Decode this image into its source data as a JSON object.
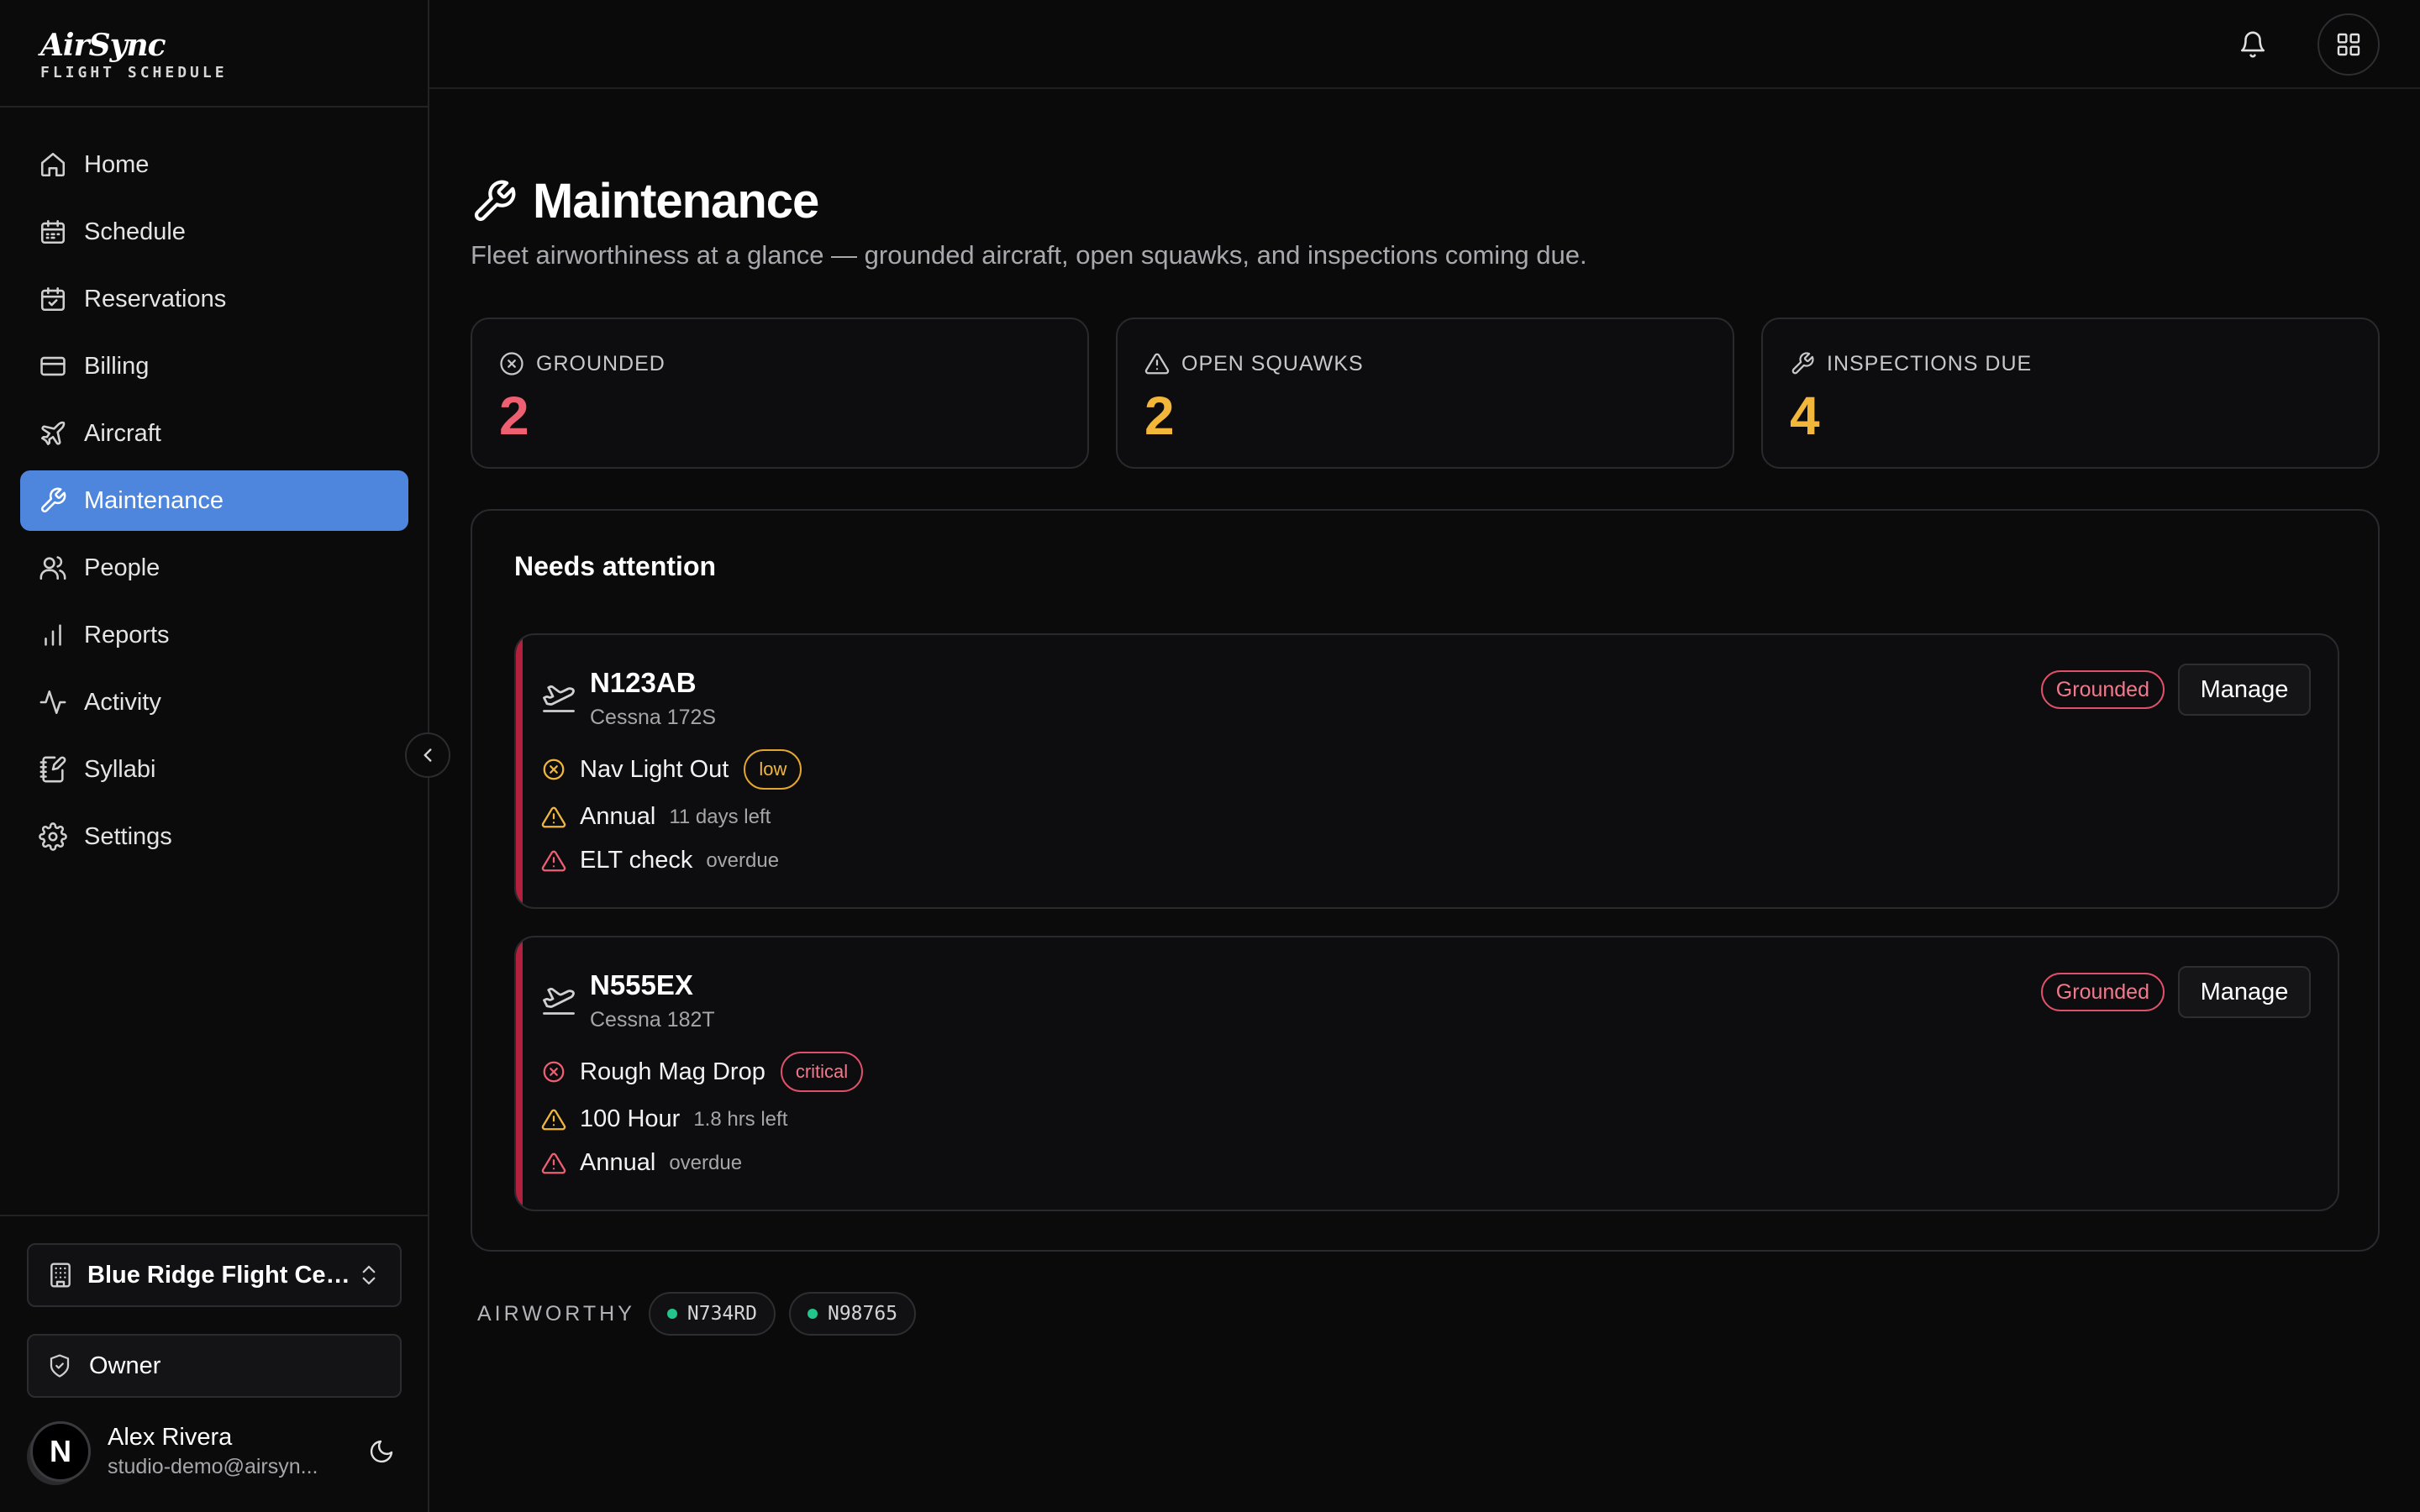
{
  "brand": {
    "logo": "AirSync",
    "subtitle": "FLIGHT SCHEDULE"
  },
  "sidebar": {
    "items": [
      {
        "label": "Home",
        "icon": "home-icon"
      },
      {
        "label": "Schedule",
        "icon": "calendar-icon"
      },
      {
        "label": "Reservations",
        "icon": "calendar-check-icon"
      },
      {
        "label": "Billing",
        "icon": "credit-card-icon"
      },
      {
        "label": "Aircraft",
        "icon": "plane-icon"
      },
      {
        "label": "Maintenance",
        "icon": "wrench-icon",
        "active": true
      },
      {
        "label": "People",
        "icon": "users-icon"
      },
      {
        "label": "Reports",
        "icon": "bar-chart-icon"
      },
      {
        "label": "Activity",
        "icon": "activity-icon"
      },
      {
        "label": "Syllabi",
        "icon": "notebook-icon"
      },
      {
        "label": "Settings",
        "icon": "gear-icon"
      }
    ],
    "org": "Blue Ridge Flight Center",
    "role": "Owner",
    "user": {
      "name": "Alex Rivera",
      "email": "studio-demo@airsync.app",
      "initial": "N"
    }
  },
  "page": {
    "title": "Maintenance",
    "subtitle": "Fleet airworthiness at a glance — grounded aircraft, open squawks, and inspections coming due."
  },
  "stats": [
    {
      "label": "GROUNDED",
      "value": "2",
      "color": "#ee5f72",
      "icon": "x-circle-icon"
    },
    {
      "label": "OPEN SQUAWKS",
      "value": "2",
      "color": "#f2b63a",
      "icon": "warning-icon"
    },
    {
      "label": "INSPECTIONS DUE",
      "value": "4",
      "color": "#f2b63a",
      "icon": "wrench-icon"
    }
  ],
  "attention": {
    "title": "Needs attention",
    "cards": [
      {
        "tail": "N123AB",
        "model": "Cessna 172S",
        "status": "Grounded",
        "action": "Manage",
        "squawk": {
          "name": "Nav Light Out",
          "severity": "low"
        },
        "inspections": [
          {
            "name": "Annual",
            "meta": "11 days left",
            "level": "warning"
          },
          {
            "name": "ELT check",
            "meta": "overdue",
            "level": "overdue"
          }
        ]
      },
      {
        "tail": "N555EX",
        "model": "Cessna 182T",
        "status": "Grounded",
        "action": "Manage",
        "squawk": {
          "name": "Rough Mag Drop",
          "severity": "critical"
        },
        "inspections": [
          {
            "name": "100 Hour",
            "meta": "1.8 hrs left",
            "level": "warning"
          },
          {
            "name": "Annual",
            "meta": "overdue",
            "level": "overdue"
          }
        ]
      }
    ]
  },
  "airworthy": {
    "label": "AIRWORTHY",
    "aircraft": [
      "N734RD",
      "N98765"
    ]
  },
  "colors": {
    "accent": "#4e86dd",
    "danger": "#ee5f72",
    "warning": "#f2b63a",
    "success": "#22c58b"
  }
}
